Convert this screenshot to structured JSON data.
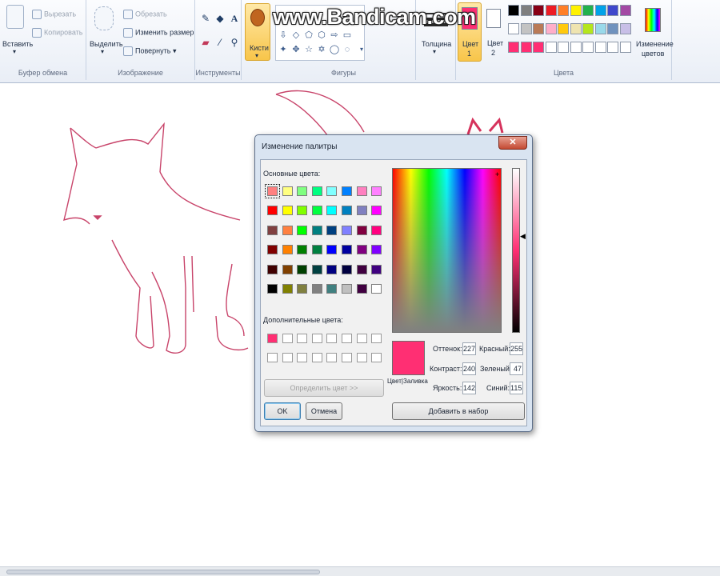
{
  "watermark": "www.Bandicam.com",
  "ribbon": {
    "clipboard": {
      "paste": "Вставить",
      "cut": "Вырезать",
      "copy": "Копировать",
      "caption": "Буфер обмена"
    },
    "image": {
      "select": "Выделить",
      "crop": "Обрезать",
      "resize": "Изменить размер",
      "rotate": "Повернуть",
      "caption": "Изображение"
    },
    "tools": {
      "caption": "Инструменты"
    },
    "brushes": "Кисти",
    "shapes": {
      "caption": "Фигуры"
    },
    "size": "Толщина",
    "color1": {
      "label": "Цвет",
      "num": "1"
    },
    "color2": {
      "label": "Цвет",
      "num": "2"
    },
    "edit_colors": {
      "line1": "Изменение",
      "line2": "цветов"
    },
    "colors_caption": "Цвета",
    "palette": [
      [
        "#000000",
        "#7f7f7f",
        "#880015",
        "#ed1c24",
        "#ff7f27",
        "#fff200",
        "#22b14c",
        "#00a2e8",
        "#3f48cc",
        "#a349a4"
      ],
      [
        "#ffffff",
        "#c3c3c3",
        "#b97a57",
        "#ffaec9",
        "#ffc90e",
        "#efe4b0",
        "#b5e61d",
        "#99d9ea",
        "#7092be",
        "#c8bfe7"
      ],
      [
        "#ff2f73",
        "#ff2f73",
        "#ff2f73",
        "#ffffff",
        "#ffffff",
        "#ffffff",
        "#ffffff",
        "#ffffff",
        "#ffffff",
        "#ffffff"
      ]
    ],
    "color1_value": "#ff2f73",
    "color2_value": "#ffffff"
  },
  "dialog": {
    "title": "Изменение палитры",
    "close": "✕",
    "basic_label": "Основные цвета:",
    "basic_colors": [
      [
        "#ff8080",
        "#ffff80",
        "#80ff80",
        "#00ff80",
        "#80ffff",
        "#0080ff",
        "#ff80c0",
        "#ff80ff"
      ],
      [
        "#ff0000",
        "#ffff00",
        "#80ff00",
        "#00ff40",
        "#00ffff",
        "#0080c0",
        "#8080c0",
        "#ff00ff"
      ],
      [
        "#804040",
        "#ff8040",
        "#00ff00",
        "#008080",
        "#004080",
        "#8080ff",
        "#800040",
        "#ff0080"
      ],
      [
        "#800000",
        "#ff8000",
        "#008000",
        "#008040",
        "#0000ff",
        "#0000a0",
        "#800080",
        "#8000ff"
      ],
      [
        "#400000",
        "#804000",
        "#004000",
        "#004040",
        "#000080",
        "#000040",
        "#400040",
        "#400080"
      ],
      [
        "#000000",
        "#808000",
        "#808040",
        "#808080",
        "#408080",
        "#c0c0c0",
        "#400040",
        "#ffffff"
      ]
    ],
    "custom_label": "Дополнительные цвета:",
    "custom_colors": [
      [
        "#ff2f73",
        "#ffffff",
        "#ffffff",
        "#ffffff",
        "#ffffff",
        "#ffffff",
        "#ffffff",
        "#ffffff"
      ],
      [
        "#ffffff",
        "#ffffff",
        "#ffffff",
        "#ffffff",
        "#ffffff",
        "#ffffff",
        "#ffffff",
        "#ffffff"
      ]
    ],
    "define_button": "Определить цвет >>",
    "ok": "OK",
    "cancel": "Отмена",
    "preview_label": "Цвет|Заливка",
    "hue_label": "Оттенок:",
    "hue": "227",
    "sat_label": "Контраст:",
    "sat": "240",
    "lum_label": "Яркость:",
    "lum": "142",
    "red_label": "Красный:",
    "red": "255",
    "green_label": "Зеленый:",
    "green": "47",
    "blue_label": "Синий:",
    "blue": "115",
    "add_button": "Добавить в набор",
    "current_color": "#ff2f73"
  }
}
